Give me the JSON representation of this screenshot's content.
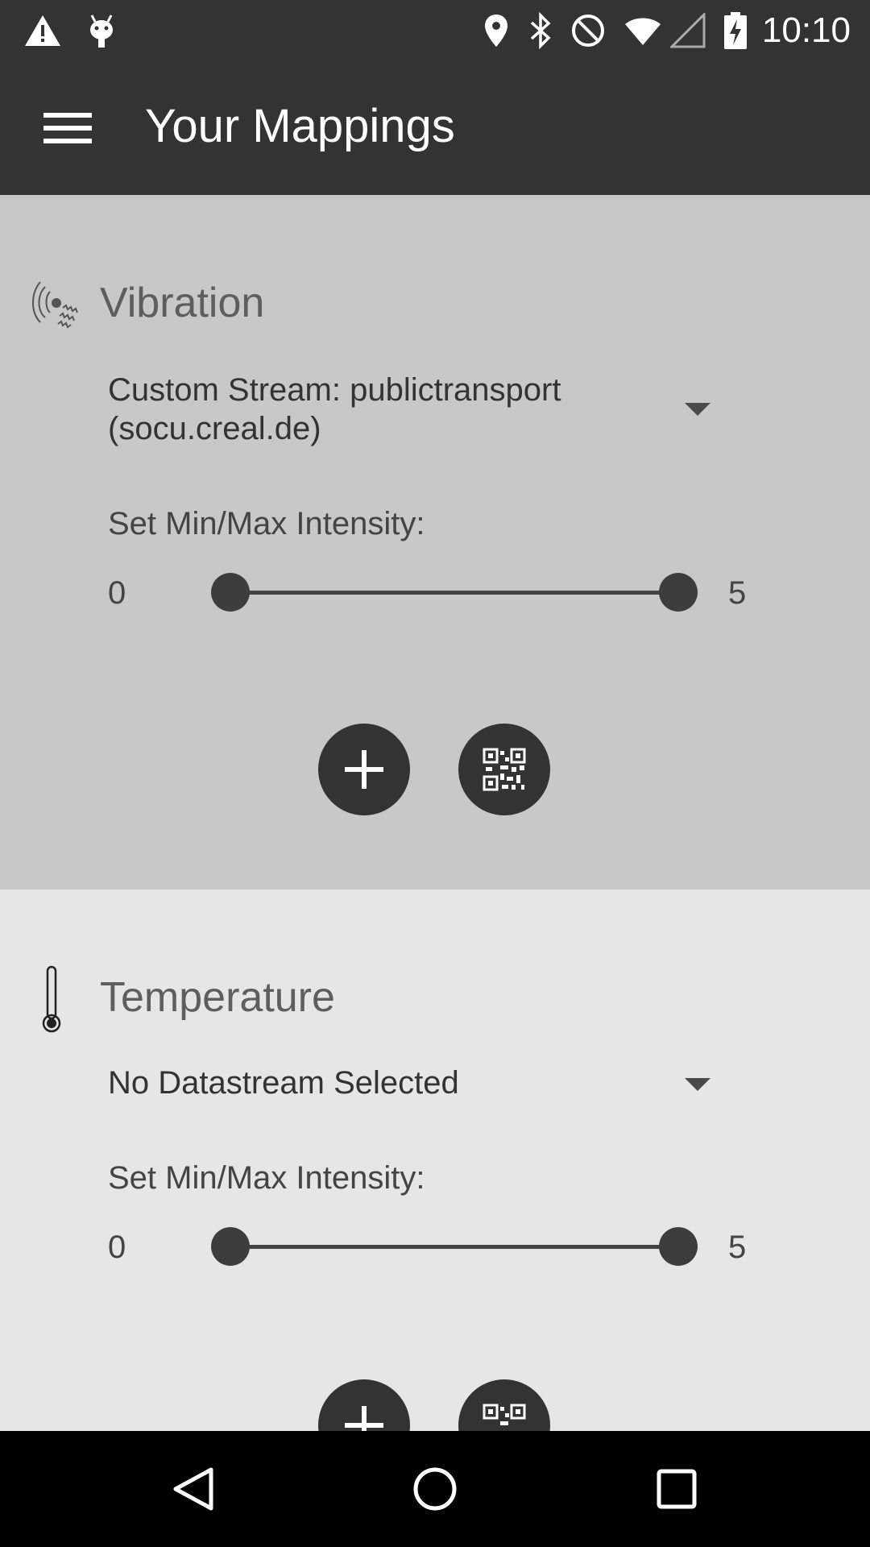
{
  "status_bar": {
    "time": "10:10",
    "icons": [
      "warning-icon",
      "android-icon",
      "location-icon",
      "bluetooth-icon",
      "do-not-disturb-icon",
      "wifi-icon",
      "signal-icon",
      "battery-charging-icon"
    ]
  },
  "app_bar": {
    "title": "Your Mappings",
    "menu_icon": "hamburger-menu-icon"
  },
  "colors": {
    "bar": "#333333",
    "card_active": "#c8c8c8",
    "card_inactive": "#e6e6e6",
    "nav": "#000000"
  },
  "mappings": [
    {
      "name": "Vibration",
      "icon": "vibration-icon",
      "stream": "Custom Stream: publictransport (socu.creal.de)",
      "intensity_label": "Set Min/Max Intensity:",
      "min_label": "0",
      "max_label": "5",
      "range_min": 0,
      "range_max": 5,
      "selected_min": 0,
      "selected_max": 5,
      "add_icon": "plus-icon",
      "qr_icon": "qr-code-icon"
    },
    {
      "name": "Temperature",
      "icon": "thermometer-icon",
      "stream": "No Datastream Selected",
      "intensity_label": "Set Min/Max Intensity:",
      "min_label": "0",
      "max_label": "5",
      "range_min": 0,
      "range_max": 5,
      "selected_min": 0,
      "selected_max": 5,
      "add_icon": "plus-icon",
      "qr_icon": "qr-code-icon"
    }
  ],
  "nav_bar": {
    "icons": [
      "back-icon",
      "home-icon",
      "recents-icon"
    ]
  }
}
